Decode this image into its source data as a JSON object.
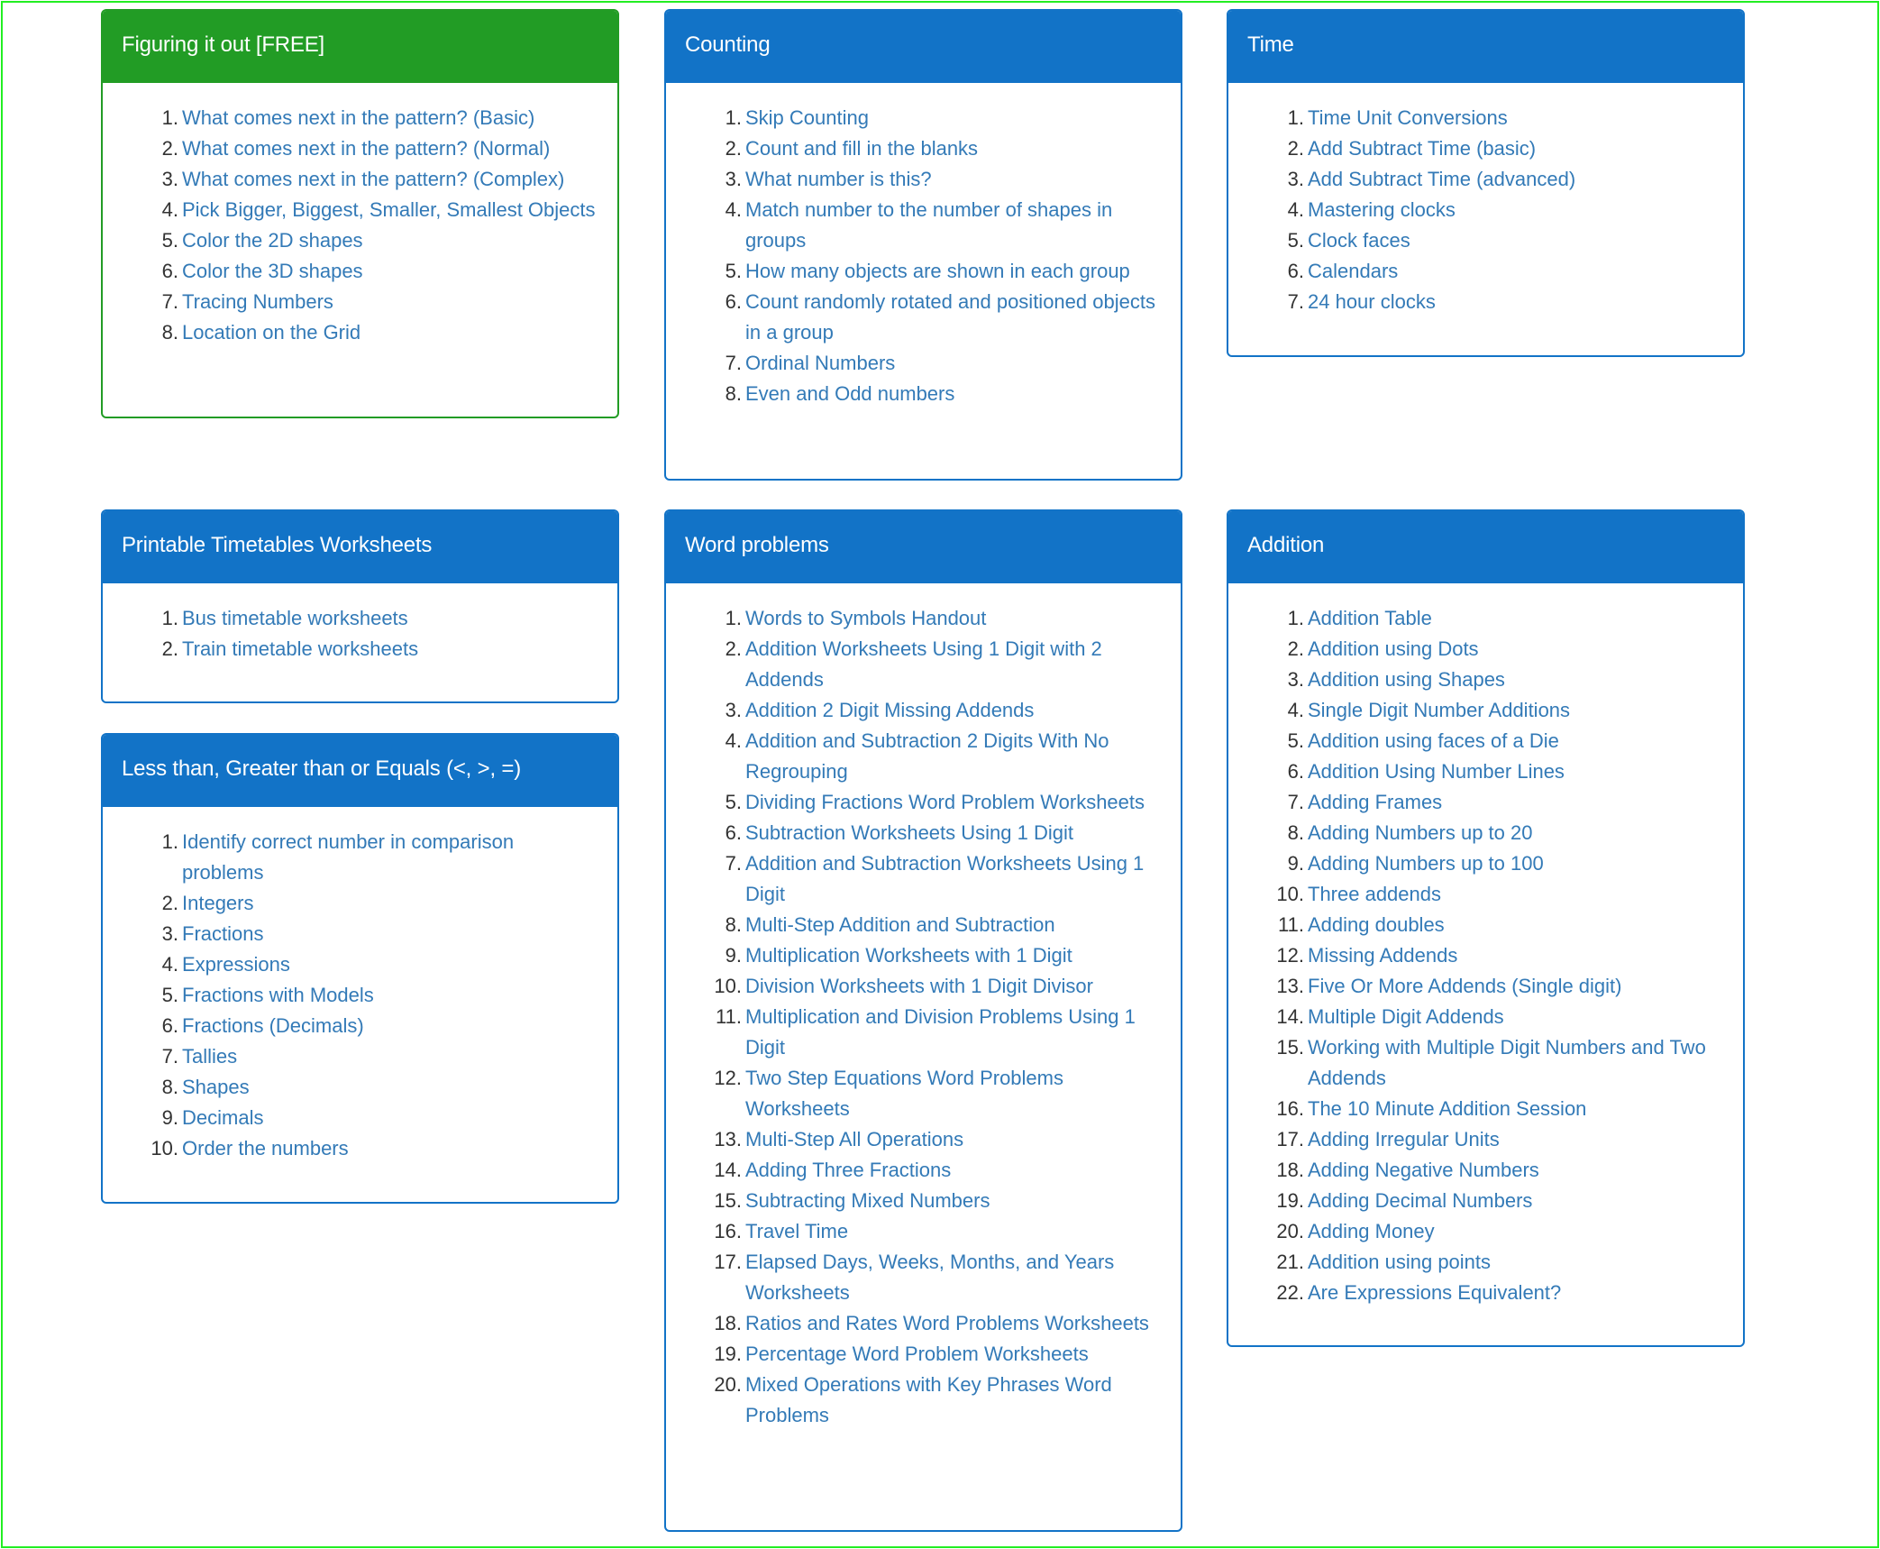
{
  "panels": {
    "figuring": {
      "title": "Figuring it out [FREE]",
      "color": "#229c25",
      "items": [
        "What comes next in the pattern? (Basic)",
        "What comes next in the pattern? (Normal)",
        "What comes next in the pattern? (Complex)",
        "Pick Bigger, Biggest, Smaller, Smallest Objects",
        "Color the 2D shapes",
        "Color the 3D shapes",
        "Tracing Numbers",
        "Location on the Grid"
      ]
    },
    "counting": {
      "title": "Counting",
      "color": "#1273c7",
      "items": [
        "Skip Counting",
        "Count and fill in the blanks",
        "What number is this?",
        "Match number to the number of shapes in groups",
        "How many objects are shown in each group",
        "Count randomly rotated and positioned objects in a group",
        "Ordinal Numbers",
        "Even and Odd numbers"
      ]
    },
    "time": {
      "title": "Time",
      "color": "#1273c7",
      "items": [
        "Time Unit Conversions",
        "Add Subtract Time (basic)",
        "Add Subtract Time (advanced)",
        "Mastering clocks",
        "Clock faces",
        "Calendars",
        "24 hour clocks"
      ]
    },
    "printable": {
      "title": "Printable Timetables Worksheets",
      "color": "#1273c7",
      "items": [
        "Bus timetable worksheets",
        "Train timetable worksheets"
      ]
    },
    "lessthan": {
      "title": "Less than, Greater than or Equals (<, >, =)",
      "color": "#1273c7",
      "items": [
        "Identify correct number in comparison problems",
        "Integers",
        "Fractions",
        "Expressions",
        "Fractions with Models",
        "Fractions (Decimals)",
        "Tallies",
        "Shapes",
        "Decimals",
        "Order the numbers"
      ]
    },
    "word": {
      "title": "Word problems",
      "color": "#1273c7",
      "items": [
        "Words to Symbols Handout",
        "Addition Worksheets Using 1 Digit with 2 Addends",
        "Addition 2 Digit Missing Addends",
        "Addition and Subtraction 2 Digits With No Regrouping",
        "Dividing Fractions Word Problem Worksheets",
        "Subtraction Worksheets Using 1 Digit",
        "Addition and Subtraction Worksheets Using 1 Digit",
        "Multi-Step Addition and Subtraction",
        "Multiplication Worksheets with 1 Digit",
        "Division Worksheets with 1 Digit Divisor",
        "Multiplication and Division Problems Using 1 Digit",
        "Two Step Equations Word Problems Worksheets",
        "Multi-Step All Operations",
        "Adding Three Fractions",
        "Subtracting Mixed Numbers",
        "Travel Time",
        "Elapsed Days, Weeks, Months, and Years Worksheets",
        "Ratios and Rates Word Problems Worksheets",
        "Percentage Word Problem Worksheets",
        "Mixed Operations with Key Phrases Word Problems"
      ]
    },
    "addition": {
      "title": "Addition",
      "color": "#1273c7",
      "items": [
        "Addition Table",
        "Addition using Dots",
        "Addition using Shapes",
        "Single Digit Number Additions",
        "Addition using faces of a Die",
        "Addition Using Number Lines",
        "Adding Frames",
        "Adding Numbers up to 20",
        "Adding Numbers up to 100",
        "Three addends",
        "Adding doubles",
        "Missing Addends",
        "Five Or More Addends (Single digit)",
        "Multiple Digit Addends",
        "Working with Multiple Digit Numbers and Two Addends",
        "The 10 Minute Addition Session",
        "Adding Irregular Units",
        "Adding Negative Numbers",
        "Adding Decimal Numbers",
        "Adding Money",
        "Addition using points",
        "Are Expressions Equivalent?"
      ]
    }
  },
  "colors": {
    "link": "#337ab7",
    "number": "#333333",
    "header_blue": "#1273c7",
    "header_green": "#229c25",
    "frame": "#22ee22"
  }
}
